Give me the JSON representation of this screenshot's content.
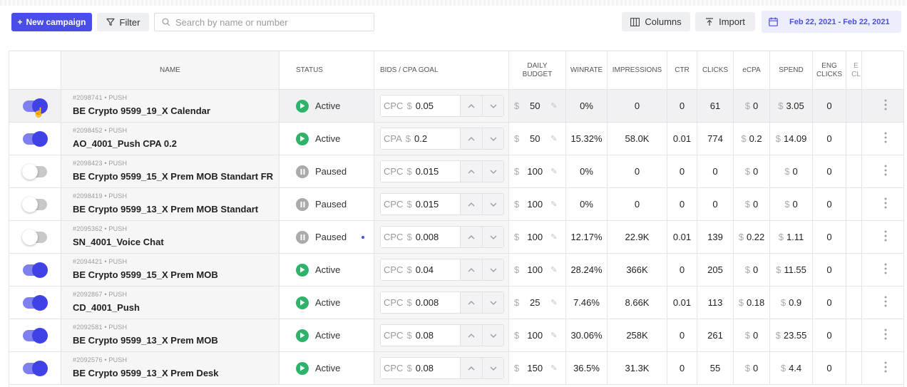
{
  "toolbar": {
    "new_campaign": "New campaign",
    "new_campaign_icon": "+",
    "filter": "Filter",
    "search_placeholder": "Search by name or number",
    "columns": "Columns",
    "import": "Import",
    "date_range": "Feb 22, 2021 - Feb 22, 2021"
  },
  "colors": {
    "accent": "#4b4de8",
    "active": "#2fb36b",
    "paused": "#a9a9ae",
    "date_bg": "#eceefe"
  },
  "columns": {
    "name": "NAME",
    "status": "STATUS",
    "bids": "BIDS / CPA GOAL",
    "budget": "DAILY BUDGET",
    "winrate": "WINRATE",
    "impressions": "IMPRESSIONS",
    "ctr": "CTR",
    "clicks": "CLICKS",
    "ecpa": "eCPA",
    "spend": "SPEND",
    "eng_clicks": "ENG CLICKS",
    "extra": "E CL"
  },
  "rows": [
    {
      "enabled": true,
      "meta": "#2098741 • PUSH",
      "name": "BE Crypto 9599_19_X Calendar",
      "status": "Active",
      "bid_type": "CPC",
      "currency": "$",
      "bid": "0.05",
      "budget": "50",
      "winrate": "0%",
      "impressions": "0",
      "ctr": "0",
      "clicks": "61",
      "ecpa": "0",
      "spend": "3.05",
      "eng_clicks": "0"
    },
    {
      "enabled": true,
      "meta": "#2098452 • PUSH",
      "name": "AO_4001_Push CPA 0.2",
      "status": "Active",
      "bid_type": "CPA",
      "currency": "$",
      "bid": "0.2",
      "budget": "50",
      "winrate": "15.32%",
      "impressions": "58.0K",
      "ctr": "0.01",
      "clicks": "774",
      "ecpa": "0.2",
      "spend": "14.09",
      "eng_clicks": "0"
    },
    {
      "enabled": false,
      "meta": "#2098423 • PUSH",
      "name": "BE Crypto 9599_15_X Prem MOB Standart FR",
      "status": "Paused",
      "bid_type": "CPC",
      "currency": "$",
      "bid": "0.015",
      "budget": "100",
      "winrate": "0%",
      "impressions": "0",
      "ctr": "0",
      "clicks": "0",
      "ecpa": "0",
      "spend": "0",
      "eng_clicks": "0"
    },
    {
      "enabled": false,
      "meta": "#2098419 • PUSH",
      "name": "BE Crypto 9599_13_X Prem MOB Standart",
      "status": "Paused",
      "bid_type": "CPC",
      "currency": "$",
      "bid": "0.015",
      "budget": "100",
      "winrate": "0%",
      "impressions": "0",
      "ctr": "0",
      "clicks": "0",
      "ecpa": "0",
      "spend": "0",
      "eng_clicks": "0"
    },
    {
      "enabled": false,
      "meta": "#2095362 • PUSH",
      "name": "SN_4001_Voice Chat",
      "status": "Paused",
      "bid_type": "CPC",
      "currency": "$",
      "bid": "0.008",
      "budget": "100",
      "winrate": "12.17%",
      "impressions": "22.9K",
      "ctr": "0.01",
      "clicks": "139",
      "ecpa": "0.22",
      "spend": "1.11",
      "eng_clicks": "0"
    },
    {
      "enabled": true,
      "meta": "#2094421 • PUSH",
      "name": "BE Crypto 9599_15_X Prem MOB",
      "status": "Active",
      "bid_type": "CPC",
      "currency": "$",
      "bid": "0.04",
      "budget": "100",
      "winrate": "28.24%",
      "impressions": "366K",
      "ctr": "0",
      "clicks": "205",
      "ecpa": "0",
      "spend": "11.55",
      "eng_clicks": "0"
    },
    {
      "enabled": true,
      "meta": "#2092867 • PUSH",
      "name": "CD_4001_Push",
      "status": "Active",
      "bid_type": "CPC",
      "currency": "$",
      "bid": "0.008",
      "budget": "25",
      "winrate": "7.46%",
      "impressions": "8.66K",
      "ctr": "0.01",
      "clicks": "113",
      "ecpa": "0.18",
      "spend": "0.9",
      "eng_clicks": "0"
    },
    {
      "enabled": true,
      "meta": "#2092581 • PUSH",
      "name": "BE Crypto 9599_13_X Prem MOB",
      "status": "Active",
      "bid_type": "CPC",
      "currency": "$",
      "bid": "0.08",
      "budget": "100",
      "winrate": "30.06%",
      "impressions": "258K",
      "ctr": "0",
      "clicks": "261",
      "ecpa": "0",
      "spend": "23.55",
      "eng_clicks": "0"
    },
    {
      "enabled": true,
      "meta": "#2092576 • PUSH",
      "name": "BE Crypto 9599_13_X Prem Desk",
      "status": "Active",
      "bid_type": "CPC",
      "currency": "$",
      "bid": "0.08",
      "budget": "150",
      "winrate": "36.5%",
      "impressions": "31.3K",
      "ctr": "0",
      "clicks": "55",
      "ecpa": "0",
      "spend": "4.4",
      "eng_clicks": "0"
    }
  ]
}
